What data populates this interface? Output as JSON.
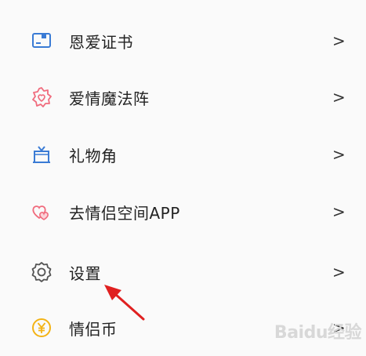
{
  "menu": {
    "items": [
      {
        "label": "恩爱证书",
        "icon": "certificate-icon",
        "chevron": ">"
      },
      {
        "label": "爱情魔法阵",
        "icon": "magic-circle-icon",
        "chevron": ">"
      },
      {
        "label": "礼物角",
        "icon": "gift-icon",
        "chevron": ">"
      },
      {
        "label": "去情侣空间APP",
        "icon": "hearts-icon",
        "chevron": ">"
      },
      {
        "label": "设置",
        "icon": "gear-icon",
        "chevron": ">"
      },
      {
        "label": "情侣币",
        "icon": "coin-icon",
        "chevron": ">"
      }
    ]
  },
  "watermark": "Baidu经验",
  "colors": {
    "certificate": "#3a7bd5",
    "magic": "#f06b7d",
    "gift": "#3a7bd5",
    "hearts": "#f06b7d",
    "gear": "#555555",
    "coin": "#f3b315",
    "arrow": "#e02020"
  }
}
